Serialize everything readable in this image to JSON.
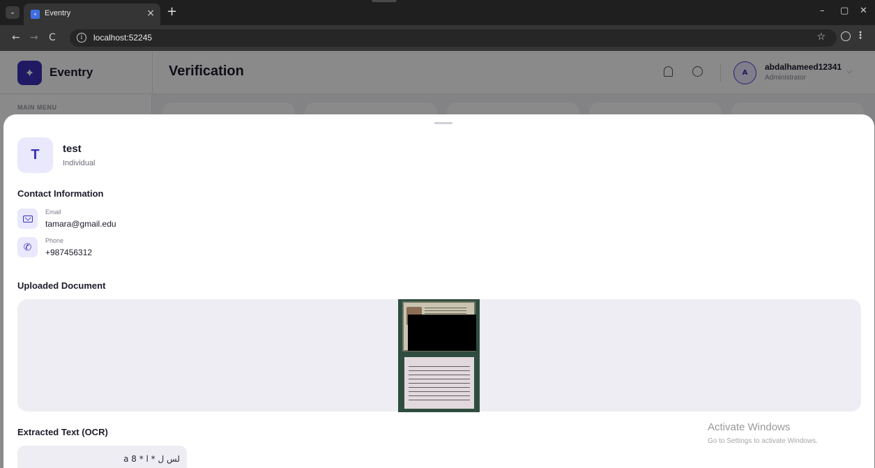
{
  "browser": {
    "tab_title": "Eventry",
    "tab_close": "×",
    "new_tab": "+",
    "url": "localhost:52245",
    "back": "←",
    "forward": "→",
    "reload": "C",
    "star": "☆",
    "menu": "⋮",
    "minimize": "–",
    "maximize": "▢",
    "close": "✕",
    "tab_menu": "⌄"
  },
  "app": {
    "brand": "Eventry",
    "page_title": "Verification",
    "main_menu_label": "MAIN MENU",
    "user": {
      "initial": "A",
      "name": "abdalhameed12341",
      "role": "Administrator"
    }
  },
  "sheet": {
    "profile": {
      "initial": "T",
      "name": "test",
      "type": "Individual"
    },
    "contact": {
      "title": "Contact Information",
      "email_label": "Email",
      "email_value": "tamara@gmail.edu",
      "phone_label": "Phone",
      "phone_value": "+987456312"
    },
    "document": {
      "title": "Uploaded Document"
    },
    "ocr": {
      "title": "Extracted Text (OCR)",
      "text": "a 8 * l * لس ل"
    }
  },
  "watermark": {
    "title": "Activate Windows",
    "subtitle": "Go to Settings to activate Windows."
  },
  "colors": {
    "accent": "#3b2fb8",
    "accent_light": "#e9e8fc",
    "panel": "#ededf3"
  },
  "icons": [
    "chevron-down-icon",
    "close-icon",
    "plus-icon",
    "back-arrow-icon",
    "forward-arrow-icon",
    "reload-icon",
    "info-icon",
    "star-icon",
    "profile-icon",
    "kebab-menu-icon",
    "bell-icon",
    "chat-icon",
    "mail-icon",
    "phone-icon"
  ]
}
